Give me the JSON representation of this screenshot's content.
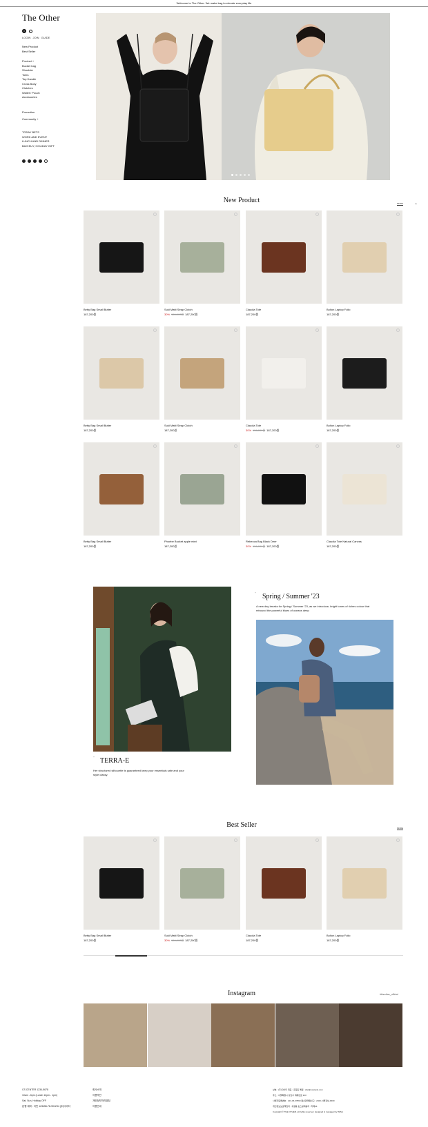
{
  "topbar": {
    "text": "Welcome to The Other. We make bag to elevate everyday life"
  },
  "header": {
    "logo": "The Other",
    "cart_count": "0",
    "login": "LOGIN",
    "join": "JOIN",
    "mypage": "GUIDE"
  },
  "nav": {
    "group1": [
      "New Product",
      "Best Seller"
    ],
    "group2": [
      "Product +",
      "Bucket bag",
      "Shoulder",
      "Totes",
      "Top Handle",
      "Cross Body",
      "Clutches",
      "Wallet / Pouch",
      "Accessories"
    ],
    "group3": [
      "Promotion",
      "Community +"
    ],
    "group4": [
      "TODAY BETS",
      "WORK AND EVENT",
      "LUNCH AND DINNER",
      "BAG BUY, HOLIDAY GIFT"
    ]
  },
  "hero": {
    "dots": 5,
    "active_dot": 0
  },
  "new_product": {
    "title": "New Product",
    "more": "MORE",
    "items": [
      {
        "name": "Betty Bag Small Butter",
        "price": "187,200원",
        "discount": "",
        "old": "",
        "bag_color": "#161616"
      },
      {
        "name": "Suki Matti Strap Clutch",
        "price": "187,200원",
        "discount": "30%",
        "old": "156,000원",
        "bag_color": "#a7b09b"
      },
      {
        "name": "Claudia Tote",
        "price": "187,200원",
        "discount": "",
        "old": "",
        "bag_color": "#6b3420"
      },
      {
        "name": "Bolton Laptop Folio",
        "price": "187,200원",
        "discount": "",
        "old": "",
        "bag_color": "#e1cfb0"
      },
      {
        "name": "Betty Bag Small Butter",
        "price": "187,200원",
        "discount": "",
        "old": "",
        "bag_color": "#dcc8a8"
      },
      {
        "name": "Suki Matti Strap Clutch",
        "price": "187,200원",
        "discount": "",
        "old": "",
        "bag_color": "#c4a47c"
      },
      {
        "name": "Claudia Tote",
        "price": "187,200원",
        "discount": "30%",
        "old": "156,000원",
        "bag_color": "#f2f0ec"
      },
      {
        "name": "Bolton Laptop Folio",
        "price": "187,200원",
        "discount": "",
        "old": "",
        "bag_color": "#1c1c1c"
      },
      {
        "name": "Betty Bag Small Butter",
        "price": "187,200원",
        "discount": "",
        "old": "",
        "bag_color": "#94603a"
      },
      {
        "name": "Phoebe Bucket apple mint",
        "price": "187,200원",
        "discount": "",
        "old": "",
        "bag_color": "#9aa593"
      },
      {
        "name": "Rebecca Bag Black Deer",
        "price": "187,200원",
        "discount": "30%",
        "old": "156,000원",
        "bag_color": "#111111"
      },
      {
        "name": "Claudia Tote Natural Canvas",
        "price": "187,200원",
        "discount": "",
        "old": "",
        "bag_color": "#ece4d5"
      }
    ]
  },
  "lookbook": {
    "ss_title": "Spring / Summer '23",
    "ss_desc": "A new day breaks for Spring / Summer '23, as we introduce, bright tones of riches colour that rebound the powerful blues of oceans deep",
    "terra_title": "TERRA-E",
    "terra_desc": "Her structured silhouette is guaranteed keep your essentials safe and your style classy."
  },
  "best_seller": {
    "title": "Best Seller",
    "more": "MORE",
    "items": [
      {
        "name": "Betty Bag Small Butter",
        "price": "187,200원",
        "discount": "",
        "old": "",
        "bag_color": "#161616"
      },
      {
        "name": "Suki Matti Strap Clutch",
        "price": "187,200원",
        "discount": "30%",
        "old": "156,000원",
        "bag_color": "#a7b09b"
      },
      {
        "name": "Claudia Tote",
        "price": "187,200원",
        "discount": "",
        "old": "",
        "bag_color": "#6b3420"
      },
      {
        "name": "Bolton Laptop Folio",
        "price": "187,200원",
        "discount": "",
        "old": "",
        "bag_color": "#e1cfb0"
      }
    ]
  },
  "instagram": {
    "title": "Instagram",
    "handle": "#theother_official",
    "tiles": [
      "#b9a58a",
      "#d7cfc6",
      "#8a6f55",
      "#6e5f52",
      "#4b3b30"
    ]
  },
  "footer": {
    "col1": [
      "CS CENTER 1234-5678",
      "10am - 6pm (Lunch 12pm - 1pm)",
      "Sat, Sun, Holiday OFF",
      "은행 계좌 : 국민 123456-78-901234 (주)디아더"
    ],
    "col2": [
      "회사소개",
      "이용약관",
      "개인정보처리방침",
      "이용안내"
    ],
    "col3": [
      "상호 : (주)디아더 대표 : 홍길동 메일 : abc@example.com",
      "주소 : 서울특별시 강남구 테헤란로 123 ",
      "사업자등록번호 : 123-45-67890 통신판매업신고 : 2023-서울강남-0000",
      "개인정보보호책임자 : 홍길동 호스팅제공자 : 카페24",
      "Copyright © THE OTHER. all rights reserved. designed & managed by WISA"
    ]
  }
}
